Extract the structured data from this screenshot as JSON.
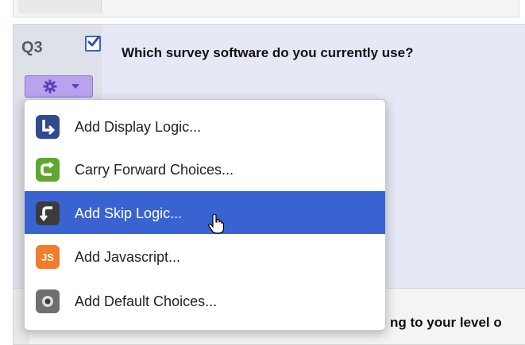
{
  "question": {
    "number": "Q3",
    "text": "Which survey software do you currently use?",
    "checked": true
  },
  "next_question": {
    "partial_text": "ng to your level o"
  },
  "options_menu": {
    "items": [
      {
        "label": "Add Display Logic...",
        "icon": "display-logic-icon",
        "icon_color": "#2f4a8f",
        "selected": false
      },
      {
        "label": "Carry Forward Choices...",
        "icon": "carry-forward-icon",
        "icon_color": "#5ea832",
        "selected": false
      },
      {
        "label": "Add Skip Logic...",
        "icon": "skip-logic-icon",
        "icon_color": "#3b3b3b",
        "selected": true
      },
      {
        "label": "Add Javascript...",
        "icon": "javascript-icon",
        "icon_color": "#ef7d2c",
        "selected": false
      },
      {
        "label": "Add Default Choices...",
        "icon": "default-choices-icon",
        "icon_color": "#6f6f6f",
        "selected": false
      }
    ]
  },
  "colors": {
    "selected_row": "#3a63d2",
    "gear_button": "#b9a3ee",
    "question_block_bg": "#e6e8f5"
  }
}
